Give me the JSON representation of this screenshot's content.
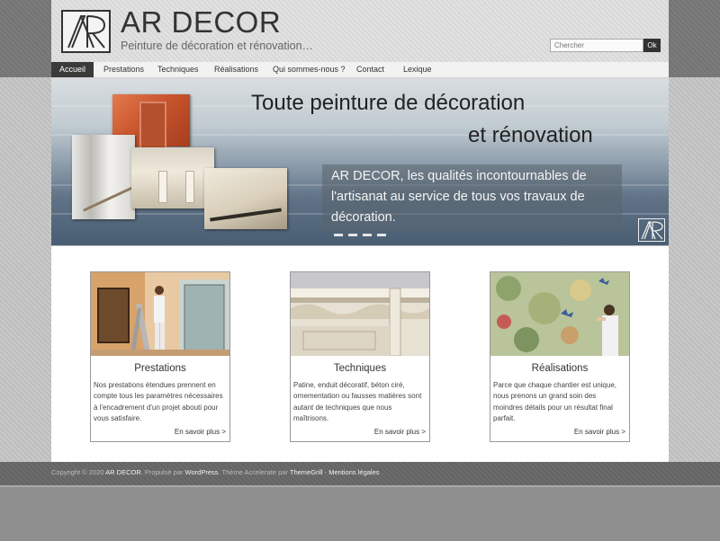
{
  "header": {
    "title": "AR DECOR",
    "tagline": "Peinture de décoration et rénovation…",
    "search_placeholder": "Chercher",
    "search_button": "Ok"
  },
  "nav": {
    "items": [
      "Accueil",
      "Prestations",
      "Techniques",
      "Réalisations",
      "Qui sommes-nous ?",
      "Contact",
      "Lexique"
    ],
    "active": "Accueil"
  },
  "hero": {
    "title_line1": "Toute peinture de décoration",
    "title_line2": "et rénovation",
    "text": "AR DECOR, les qualités incontournables de l'artisanat au service de tous vos travaux de décoration.",
    "slides": 4
  },
  "cards": [
    {
      "title": "Prestations",
      "text": "Nos prestations étendues prennent en compte tous les paramètres nécessaires à l'encadrement d'un projet abouti pour vous satisfaire.",
      "more": "En savoir plus >"
    },
    {
      "title": "Techniques",
      "text": "Patine, enduit décoratif, béton ciré, ornementation ou fausses matières sont autant de techniques que nous maîtrisons.",
      "more": "En savoir plus >"
    },
    {
      "title": "Réalisations",
      "text": "Parce que chaque chantier est unique, nous prenons un grand soin des moindres détails pour un résultat final parfait.",
      "more": "En savoir plus >"
    }
  ],
  "footer": {
    "copyright": "Copyright © 2020 ",
    "brand": "AR DECOR",
    "propulse": ". Propulsé par ",
    "wordpress": "WordPress",
    "theme": ". Thème Accelerate par ",
    "themegrill": "ThemeGrill",
    "sep": " - ",
    "legal": "Mentions légales"
  },
  "colors": {
    "nav_active_bg": "#3a3a3a",
    "header_bg": "#dcdcdc",
    "footer_bg": "#6a6a6a"
  }
}
